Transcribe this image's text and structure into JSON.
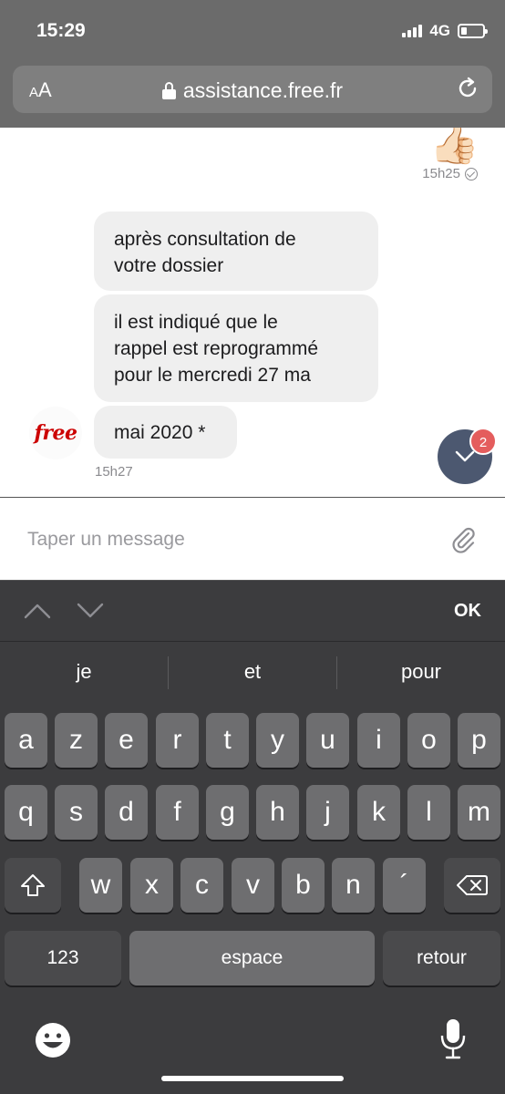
{
  "status": {
    "time": "15:29",
    "network": "4G"
  },
  "browser": {
    "aa_small": "A",
    "aa_large": "A",
    "url": "assistance.free.fr"
  },
  "chat": {
    "sent_emoji": "👍🏻",
    "sent_time": "15h25",
    "bubbles": [
      {
        "lines": [
          "après consultation de",
          "votre dossier"
        ]
      },
      {
        "lines": [
          "il est indiqué que le",
          "rappel est reprogrammé",
          "pour le mercredi 27 ma"
        ]
      },
      {
        "lines": [
          "mai 2020 *"
        ]
      }
    ],
    "received_time": "15h27",
    "avatar_logo": "free",
    "unread_count": "2"
  },
  "composer": {
    "placeholder": "Taper un message"
  },
  "keyboard": {
    "done_label": "OK",
    "suggestions": [
      "je",
      "et",
      "pour"
    ],
    "row1": [
      "a",
      "z",
      "e",
      "r",
      "t",
      "y",
      "u",
      "i",
      "o",
      "p"
    ],
    "row2": [
      "q",
      "s",
      "d",
      "f",
      "g",
      "h",
      "j",
      "k",
      "l",
      "m"
    ],
    "row3": [
      "w",
      "x",
      "c",
      "v",
      "b",
      "n",
      "´"
    ],
    "numbers_label": "123",
    "space_label": "espace",
    "return_label": "retour"
  },
  "colors": {
    "brand_red": "#cc0000",
    "fab": "#4c5870",
    "badge": "#e45d5d",
    "bubble": "#efefef"
  }
}
